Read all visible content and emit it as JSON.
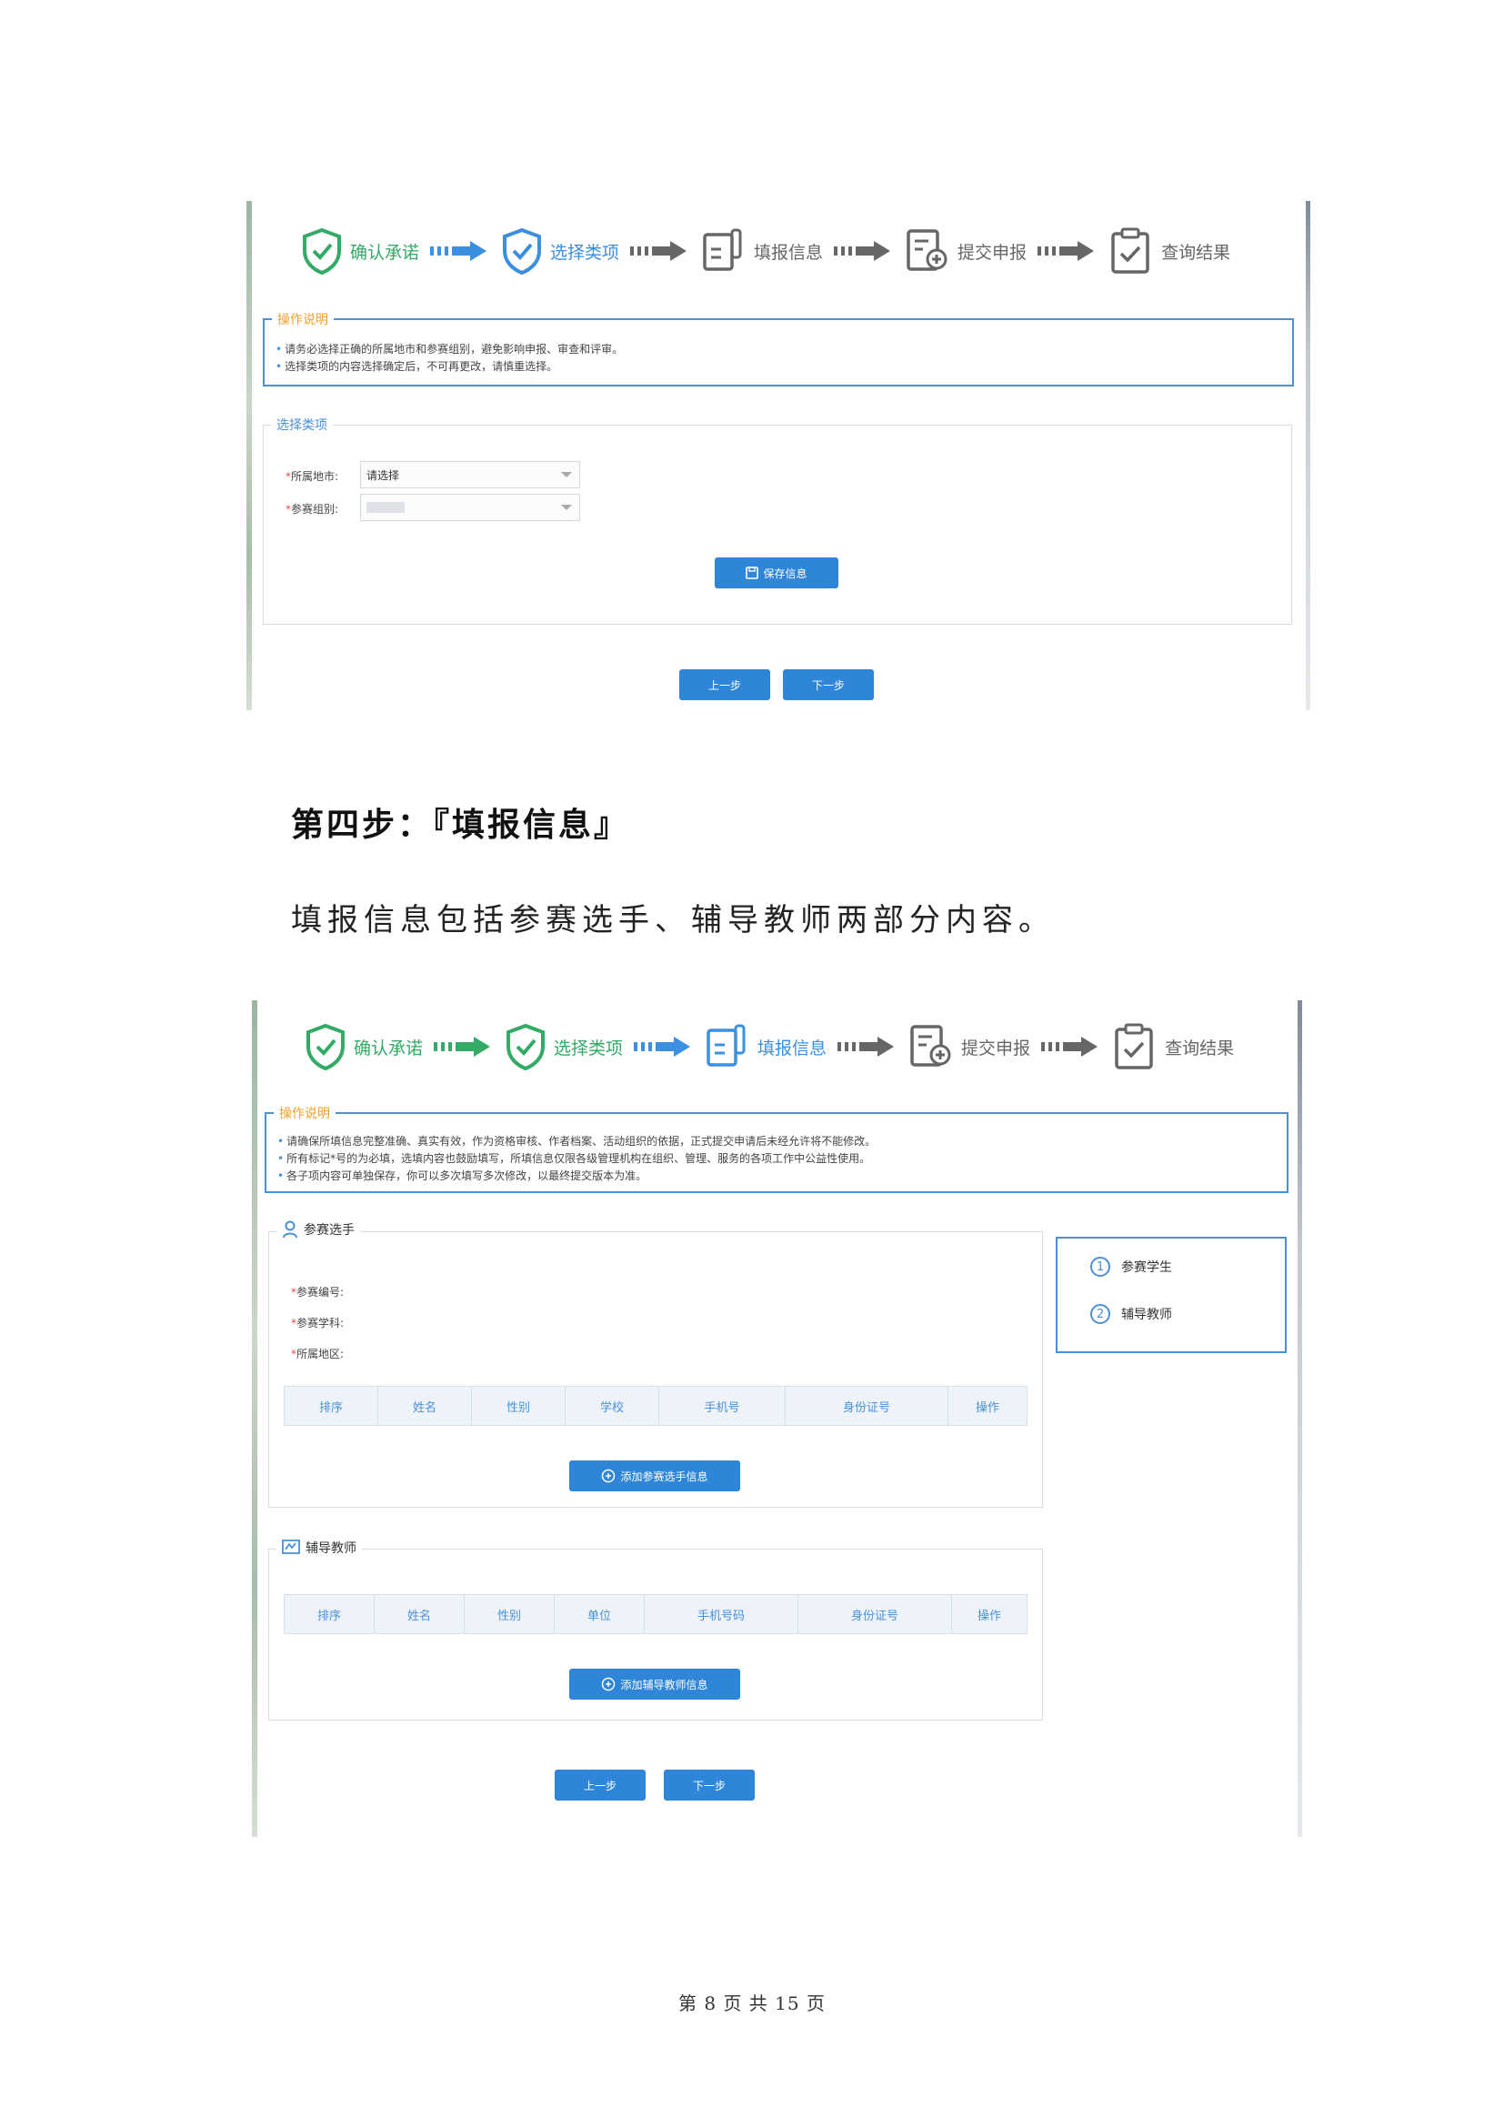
{
  "steps": [
    {
      "label": "确认承诺",
      "icon": "shield-check-icon",
      "color": "#33aa66"
    },
    {
      "label": "选择类项",
      "icon": "shield-check-icon",
      "color": "#3a8fe0"
    },
    {
      "label": "填报信息",
      "icon": "form-edit-icon"
    },
    {
      "label": "提交申报",
      "icon": "document-add-icon"
    },
    {
      "label": "查询结果",
      "icon": "clipboard-check-icon"
    }
  ],
  "screenshot1": {
    "instructions_title": "操作说明",
    "instructions": [
      "请务必选择正确的所属地市和参赛组别，避免影响申报、审查和评审。",
      "选择类项的内容选择确定后，不可再更改，请慎重选择。"
    ],
    "section_title": "选择类项",
    "fields": [
      {
        "label": "所属地市:",
        "value": "请选择"
      },
      {
        "label": "参赛组别:",
        "value": ""
      }
    ],
    "save_button": "保存信息",
    "prev_button": "上一步",
    "next_button": "下一步"
  },
  "heading": "第四步：『填报信息』",
  "paragraph": "填报信息包括参赛选手、辅导教师两部分内容。",
  "screenshot2": {
    "instructions_title": "操作说明",
    "instructions": [
      "请确保所填信息完整准确、真实有效，作为资格审核、作者档案、活动组织的依据，正式提交申请后未经允许将不能修改。",
      "所有标记*号的为必填，选填内容也鼓励填写，所填信息仅限各级管理机构在组织、管理、服务的各项工作中公益性使用。",
      "各子项内容可单独保存，你可以多次填写多次修改，以最终提交版本为准。"
    ],
    "contestant": {
      "title": "参赛选手",
      "fields": [
        "参赛编号:",
        "参赛学科:",
        "所属地区:"
      ],
      "columns": [
        "排序",
        "姓名",
        "性别",
        "学校",
        "手机号",
        "身份证号",
        "操作"
      ],
      "add_button": "添加参赛选手信息"
    },
    "teacher": {
      "title": "辅导教师",
      "columns": [
        "排序",
        "姓名",
        "性别",
        "单位",
        "手机号码",
        "身份证号",
        "操作"
      ],
      "add_button": "添加辅导教师信息"
    },
    "side_nav": [
      {
        "num": "1",
        "label": "参赛学生"
      },
      {
        "num": "2",
        "label": "辅导教师"
      }
    ],
    "prev_button": "上一步",
    "next_button": "下一步"
  },
  "footer": "第 8 页 共 15 页",
  "colors": {
    "accent": "#2f86d8",
    "notice": "#f0a030",
    "border": "#4a90d9"
  }
}
